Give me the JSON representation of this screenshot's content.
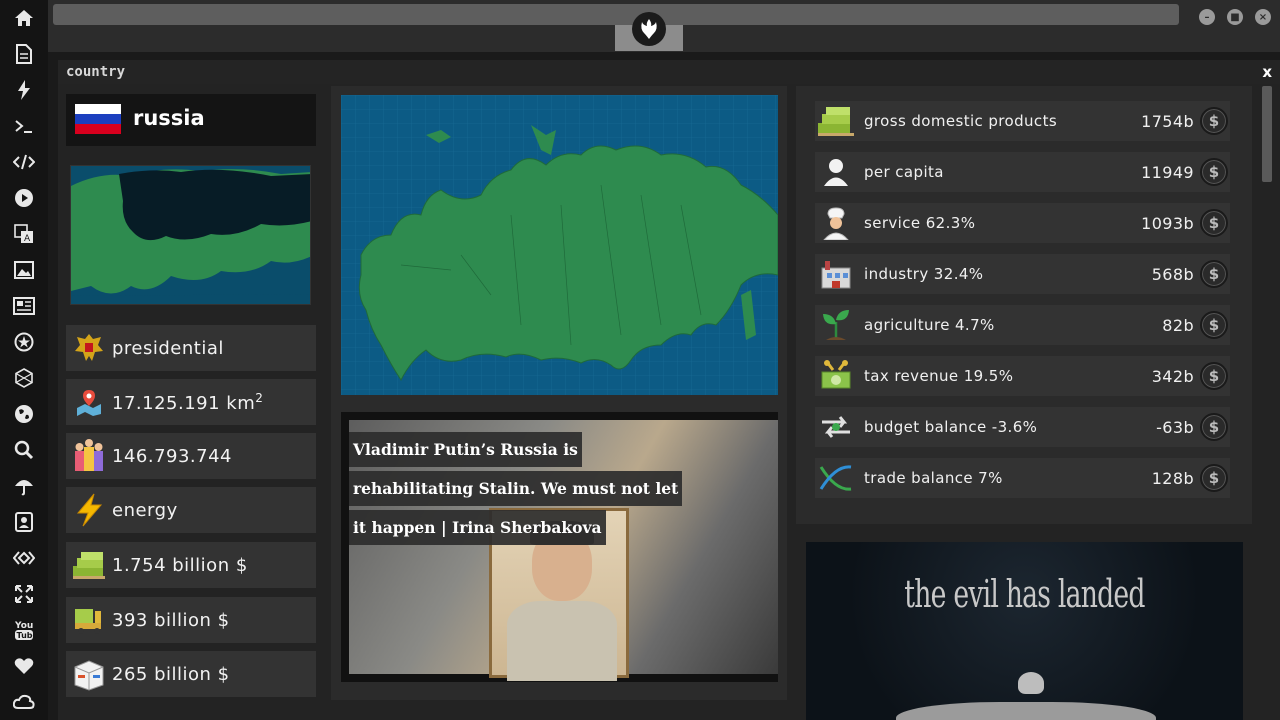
{
  "sidebar": {
    "icons": [
      "home-icon",
      "document-icon",
      "lightning-icon",
      "terminal-icon",
      "code-icon",
      "play-icon",
      "translate-icon",
      "image-icon",
      "news-icon",
      "settings-star-icon",
      "hexagon-icon",
      "globe-icon",
      "search-icon",
      "umbrella-icon",
      "contacts-icon",
      "diamond-code-icon",
      "fullscreen-icon",
      "youtube-icon",
      "heart-icon",
      "cloud-icon"
    ]
  },
  "window": {
    "title": "country",
    "close_label": "x"
  },
  "country": {
    "name": "russia",
    "government": "presidential",
    "area": "17.125.191 km",
    "area_unit_power": "2",
    "population": "146.793.744",
    "resource": "energy",
    "gdp_total": "1.754 billion $",
    "exports": "393 billion $",
    "imports": "265 billion $"
  },
  "news": {
    "headline": "Vladimir Putin’s Russia is rehabilitating Stalin. We must not let it happen | Irina Sherbakova"
  },
  "stats": [
    {
      "label": "gross domestic products",
      "value": "1754b",
      "icon": "gdp-icon"
    },
    {
      "label": "per capita",
      "value": "11949",
      "icon": "person-icon"
    },
    {
      "label": "service 62.3%",
      "value": "1093b",
      "icon": "chef-icon"
    },
    {
      "label": "industry 32.4%",
      "value": "568b",
      "icon": "factory-icon"
    },
    {
      "label": "agriculture 4.7%",
      "value": "82b",
      "icon": "plant-icon"
    },
    {
      "label": "tax revenue 19.5%",
      "value": "342b",
      "icon": "money-icon"
    },
    {
      "label": "budget balance -3.6%",
      "value": "-63b",
      "icon": "balance-arrows-icon"
    },
    {
      "label": "trade balance 7%",
      "value": "128b",
      "icon": "trade-icon"
    }
  ],
  "promo": {
    "text": "the evil has landed"
  },
  "colors": {
    "flag_white": "#ffffff",
    "flag_blue": "#1c3fbf",
    "flag_red": "#d9001e",
    "map_sea": "#0c5b85",
    "map_land": "#2e8b4f"
  }
}
